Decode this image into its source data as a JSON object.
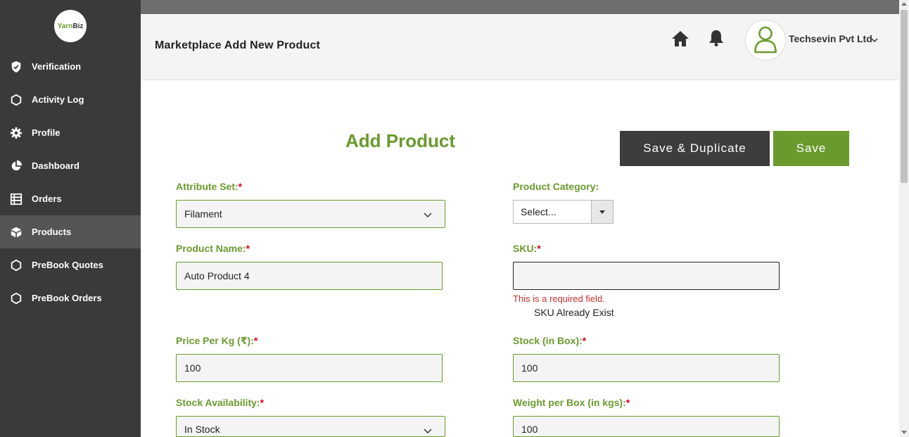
{
  "logo": {
    "part1": "Yarn",
    "part2": "Biz"
  },
  "sidebar": {
    "items": [
      {
        "label": "Verification",
        "icon": "shield-check-icon"
      },
      {
        "label": "Activity Log",
        "icon": "hexagon-icon"
      },
      {
        "label": "Profile",
        "icon": "gear-icon"
      },
      {
        "label": "Dashboard",
        "icon": "pie-chart-icon"
      },
      {
        "label": "Orders",
        "icon": "table-icon"
      },
      {
        "label": "Products",
        "icon": "cube-icon",
        "active": true
      },
      {
        "label": "PreBook Quotes",
        "icon": "hexagon-icon"
      },
      {
        "label": "PreBook Orders",
        "icon": "hexagon-icon"
      }
    ]
  },
  "header": {
    "title": "Marketplace Add New Product",
    "company": "Techsevin Pvt Ltd"
  },
  "form": {
    "heading": "Add Product",
    "save_duplicate_label": "Save & Duplicate",
    "save_label": "Save",
    "attribute_set": {
      "label": "Attribute Set:",
      "required": "*",
      "value": "Filament"
    },
    "product_category": {
      "label": "Product Category:",
      "value": "Select..."
    },
    "product_name": {
      "label": "Product Name:",
      "required": "*",
      "value": "Auto Product 4"
    },
    "sku": {
      "label": "SKU:",
      "required": "*",
      "value": "",
      "error": "This is a required field.",
      "note": "SKU Already Exist"
    },
    "price_per_kg": {
      "label": "Price Per Kg (₹):",
      "required": "*",
      "value": "100"
    },
    "stock_in_box": {
      "label": "Stock (in Box):",
      "required": "*",
      "value": "100"
    },
    "stock_availability": {
      "label": "Stock Availability:",
      "required": "*",
      "value": "In Stock"
    },
    "weight_per_box": {
      "label": "Weight per Box (in kgs):",
      "required": "*",
      "value": "100"
    }
  },
  "colors": {
    "accent": "#6a9a2e",
    "sidebar": "#3a3a3a",
    "dark_button": "#3d3d40",
    "error": "#c9302c"
  }
}
